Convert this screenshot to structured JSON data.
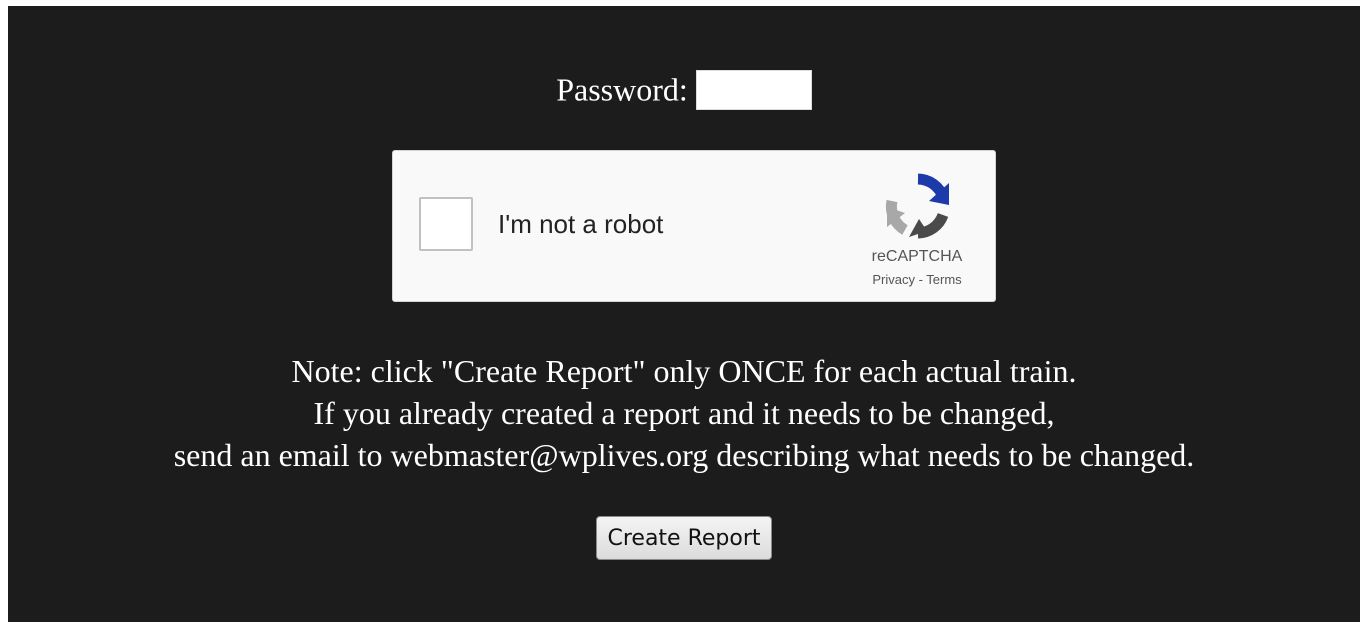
{
  "form": {
    "password_label": "Password:",
    "password_value": ""
  },
  "recaptcha": {
    "label": "I'm not a robot",
    "brand": "reCAPTCHA",
    "privacy": "Privacy",
    "separator": " - ",
    "terms": "Terms",
    "logo_icon": "recaptcha-logo-icon",
    "checked": false
  },
  "note": {
    "line1": "Note: click \"Create Report\" only ONCE for each actual train.",
    "line2": "If you already created a report and it needs to be changed,",
    "line3": "send an email to webmaster@wplives.org describing what needs to be changed."
  },
  "actions": {
    "create_report_label": "Create Report"
  },
  "colors": {
    "background": "#1c1c1c",
    "text": "#ffffff",
    "captcha_bg": "#f9f9f9"
  }
}
